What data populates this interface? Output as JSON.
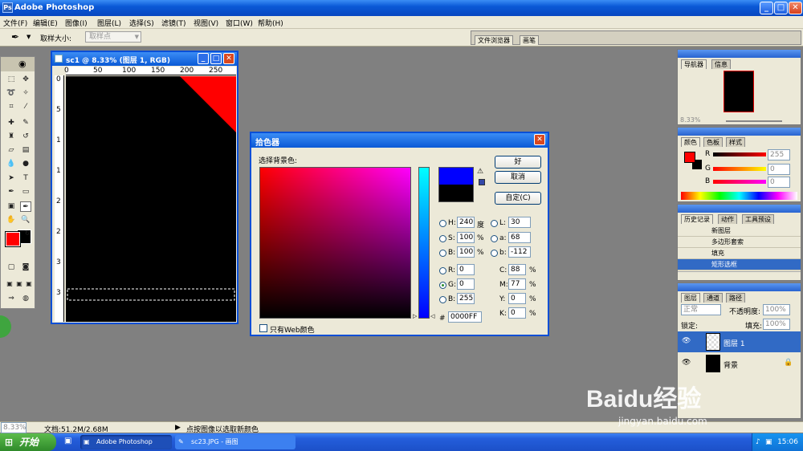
{
  "app": {
    "title": "Adobe Photoshop"
  },
  "window_buttons": {
    "min": "_",
    "max": "□",
    "close": "✕"
  },
  "menu": [
    "文件(F)",
    "编辑(E)",
    "图像(I)",
    "图层(L)",
    "选择(S)",
    "滤镜(T)",
    "视图(V)",
    "窗口(W)",
    "帮助(H)"
  ],
  "options_bar": {
    "sample_label": "取样大小:",
    "sample_value": "取样点",
    "well_tabs": [
      "文件浏览器",
      "画笔"
    ]
  },
  "document": {
    "title": "sc1 @ 8.33% (图层 1, RGB)",
    "ruler_h": [
      "0",
      "50",
      "100",
      "150",
      "200",
      "250"
    ],
    "ruler_v": [
      "0",
      "5",
      "1",
      "1",
      "2",
      "2",
      "3",
      "3"
    ]
  },
  "color_picker": {
    "title": "拾色器",
    "subtitle": "选择背景色:",
    "ok": "好",
    "cancel": "取消",
    "custom": "自定(C)",
    "hsb": [
      {
        "label": "H:",
        "value": "240",
        "unit": "度"
      },
      {
        "label": "S:",
        "value": "100",
        "unit": "%"
      },
      {
        "label": "B:",
        "value": "100",
        "unit": "%"
      }
    ],
    "rgb": [
      {
        "label": "R:",
        "value": "0"
      },
      {
        "label": "G:",
        "value": "0"
      },
      {
        "label": "B:",
        "value": "255"
      }
    ],
    "lab": [
      {
        "label": "L:",
        "value": "30"
      },
      {
        "label": "a:",
        "value": "68"
      },
      {
        "label": "b:",
        "value": "-112"
      }
    ],
    "cmyk": [
      {
        "label": "C:",
        "value": "88",
        "unit": "%"
      },
      {
        "label": "M:",
        "value": "77",
        "unit": "%"
      },
      {
        "label": "Y:",
        "value": "0",
        "unit": "%"
      },
      {
        "label": "K:",
        "value": "0",
        "unit": "%"
      }
    ],
    "hex_label": "#",
    "hex": "0000FF",
    "web_only": "只有Web颜色",
    "new_color": "#0000ff",
    "old_color": "#000000"
  },
  "navigator": {
    "tabs": [
      "导航器",
      "信息"
    ],
    "zoom": "8.33%"
  },
  "color_panel": {
    "tabs": [
      "颜色",
      "色板",
      "样式"
    ],
    "rows": [
      {
        "label": "R",
        "value": "255"
      },
      {
        "label": "G",
        "value": "0"
      },
      {
        "label": "B",
        "value": "0"
      }
    ]
  },
  "history": {
    "tabs": [
      "历史记录",
      "动作",
      "工具预设"
    ],
    "items": [
      "新图层",
      "多边形套索",
      "填充",
      "矩形选框"
    ]
  },
  "layers": {
    "tabs": [
      "图层",
      "通道",
      "路径"
    ],
    "blend": "正常",
    "opacity_label": "不透明度:",
    "opacity": "100%",
    "lock_label": "锁定:",
    "fill_label": "填充:",
    "fill": "100%",
    "items": [
      {
        "name": "图层 1"
      },
      {
        "name": "背景"
      }
    ]
  },
  "status": {
    "zoom": "8.33%",
    "doc": "文档:51.2M/2.68M",
    "hint": "点按图像以选取新颜色"
  },
  "taskbar": {
    "start": "开始",
    "tasks": [
      "Adobe Photoshop",
      "sc23.JPG - 画图"
    ],
    "time": "15:06"
  },
  "watermark": {
    "brand": "Baidu经验",
    "url": "jingyan.baidu.com"
  },
  "colors": {
    "foreground": "#ff0000",
    "background": "#000000",
    "accent": "#0a59d6"
  }
}
